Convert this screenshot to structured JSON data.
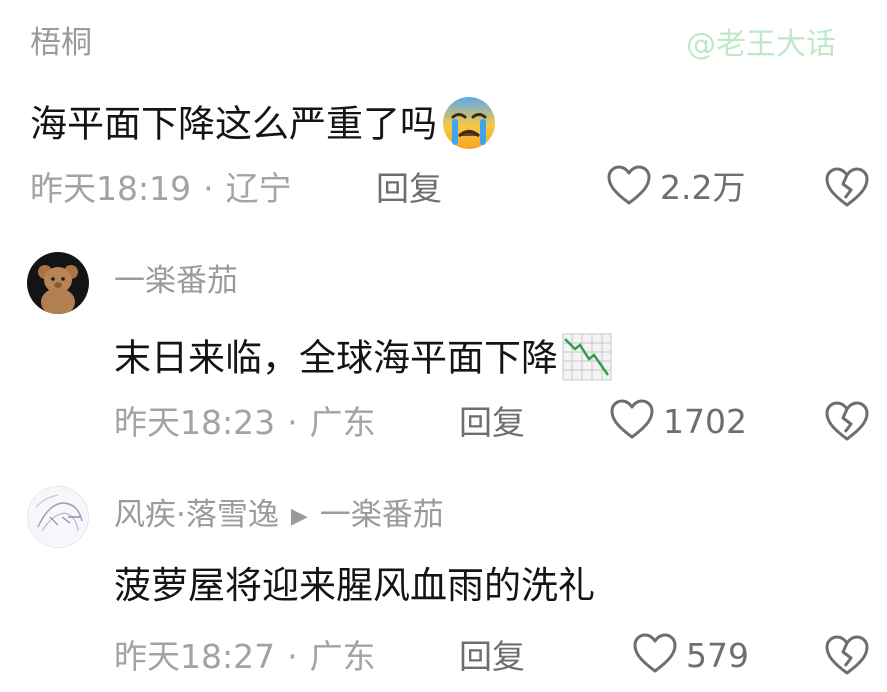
{
  "watermark": "@老王大话",
  "comments": [
    {
      "username": "梧桐",
      "content": "海平面下降这么严重了吗",
      "emoji": "crying-face-emoji",
      "time": "昨天18:19",
      "location": "辽宁",
      "reply_label": "回复",
      "likes": "2.2万"
    },
    {
      "username": "一楽番茄",
      "content": "末日来临，全球海平面下降",
      "emoji": "chart-decreasing-emoji",
      "time": "昨天18:23",
      "location": "广东",
      "reply_label": "回复",
      "likes": "1702"
    },
    {
      "username": "风疾·落雪逸",
      "reply_to": "一楽番茄",
      "content": "菠萝屋将迎来腥风血雨的洗礼",
      "time": "昨天18:27",
      "location": "广东",
      "reply_label": "回复",
      "likes": "579"
    }
  ],
  "separator": "·",
  "colors": {
    "username": "#9b9b9b",
    "content": "#141414",
    "meta": "#a3a3a3",
    "watermark": "#bfe8c6"
  }
}
